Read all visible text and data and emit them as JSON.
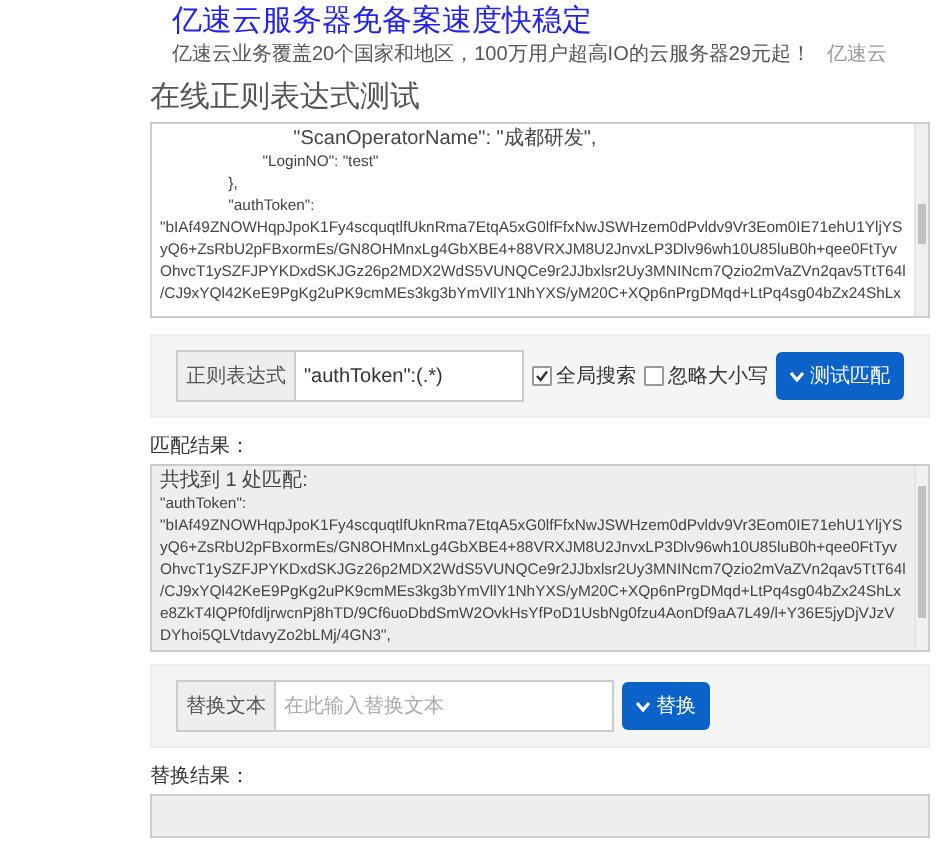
{
  "ad": {
    "headline": "亿速云服务器免备案速度快稳定",
    "text": "亿速云业务覆盖20个国家和地区，100万用户超高IO的云服务器29元起！",
    "brand": "亿速云"
  },
  "page_title": "在线正则表达式测试",
  "source_lines": [
    "                        \"ScanOperatorName\": \"成都研发\",",
    "                        \"LoginNO\": \"test\"",
    "                },",
    "                \"authToken\":",
    "\"bIAf49ZNOWHqpJpoK1Fy4scquqtlfUknRma7EtqA5xG0lfFfxNwJSWHzem0dPvldv9Vr3Eom0IE71ehU1YljYS",
    "yQ6+ZsRbU2pFBxormEs/GN8OHMnxLg4GbXBE4+88VRXJM8U2JnvxLP3Dlv96wh10U85luB0h+qee0FtTyv",
    "OhvcT1ySZFJPYKDxdSKJGz26p2MDX2WdS5VUNQCe9r2JJbxlsr2Uy3MNINcm7Qzio2mVaZVn2qav5TtT64l",
    "/CJ9xYQl42KeE9PgKg2uPK9cmMEs3kg3bYmVllY1NhYXS/yM20C+XQp6nPrgDMqd+LtPq4sg04bZx24ShLx"
  ],
  "regex": {
    "label": "正则表达式",
    "value": "\"authToken\":(.*)",
    "options": [
      {
        "label": "全局搜索",
        "checked": true
      },
      {
        "label": "忽略大小写",
        "checked": false
      }
    ],
    "button": "测试匹配"
  },
  "match": {
    "label": "匹配结果：",
    "lines": [
      "共找到 1 处匹配:",
      "\"authToken\":",
      "\"bIAf49ZNOWHqpJpoK1Fy4scquqtlfUknRma7EtqA5xG0lfFfxNwJSWHzem0dPvldv9Vr3Eom0IE71ehU1YljYS",
      "yQ6+ZsRbU2pFBxormEs/GN8OHMnxLg4GbXBE4+88VRXJM8U2JnvxLP3Dlv96wh10U85luB0h+qee0FtTyv",
      "OhvcT1ySZFJPYKDxdSKJGz26p2MDX2WdS5VUNQCe9r2JJbxlsr2Uy3MNINcm7Qzio2mVaZVn2qav5TtT64l",
      "/CJ9xYQl42KeE9PgKg2uPK9cmMEs3kg3bYmVllY1NhYXS/yM20C+XQp6nPrgDMqd+LtPq4sg04bZx24ShLx",
      "e8ZkT4lQPf0fdljrwcnPj8hTD/9Cf6uoDbdSmW2OvkHsYfPoD1UsbNg0fzu4AonDf9aA7L49/l+Y36E5jyDjVJzV",
      "DYhoi5QLVtdavyZo2bLMj/4GN3\","
    ]
  },
  "replace": {
    "label": "替换文本",
    "placeholder": "在此输入替换文本",
    "button": "替换"
  },
  "replace_result": {
    "label": "替换结果："
  }
}
